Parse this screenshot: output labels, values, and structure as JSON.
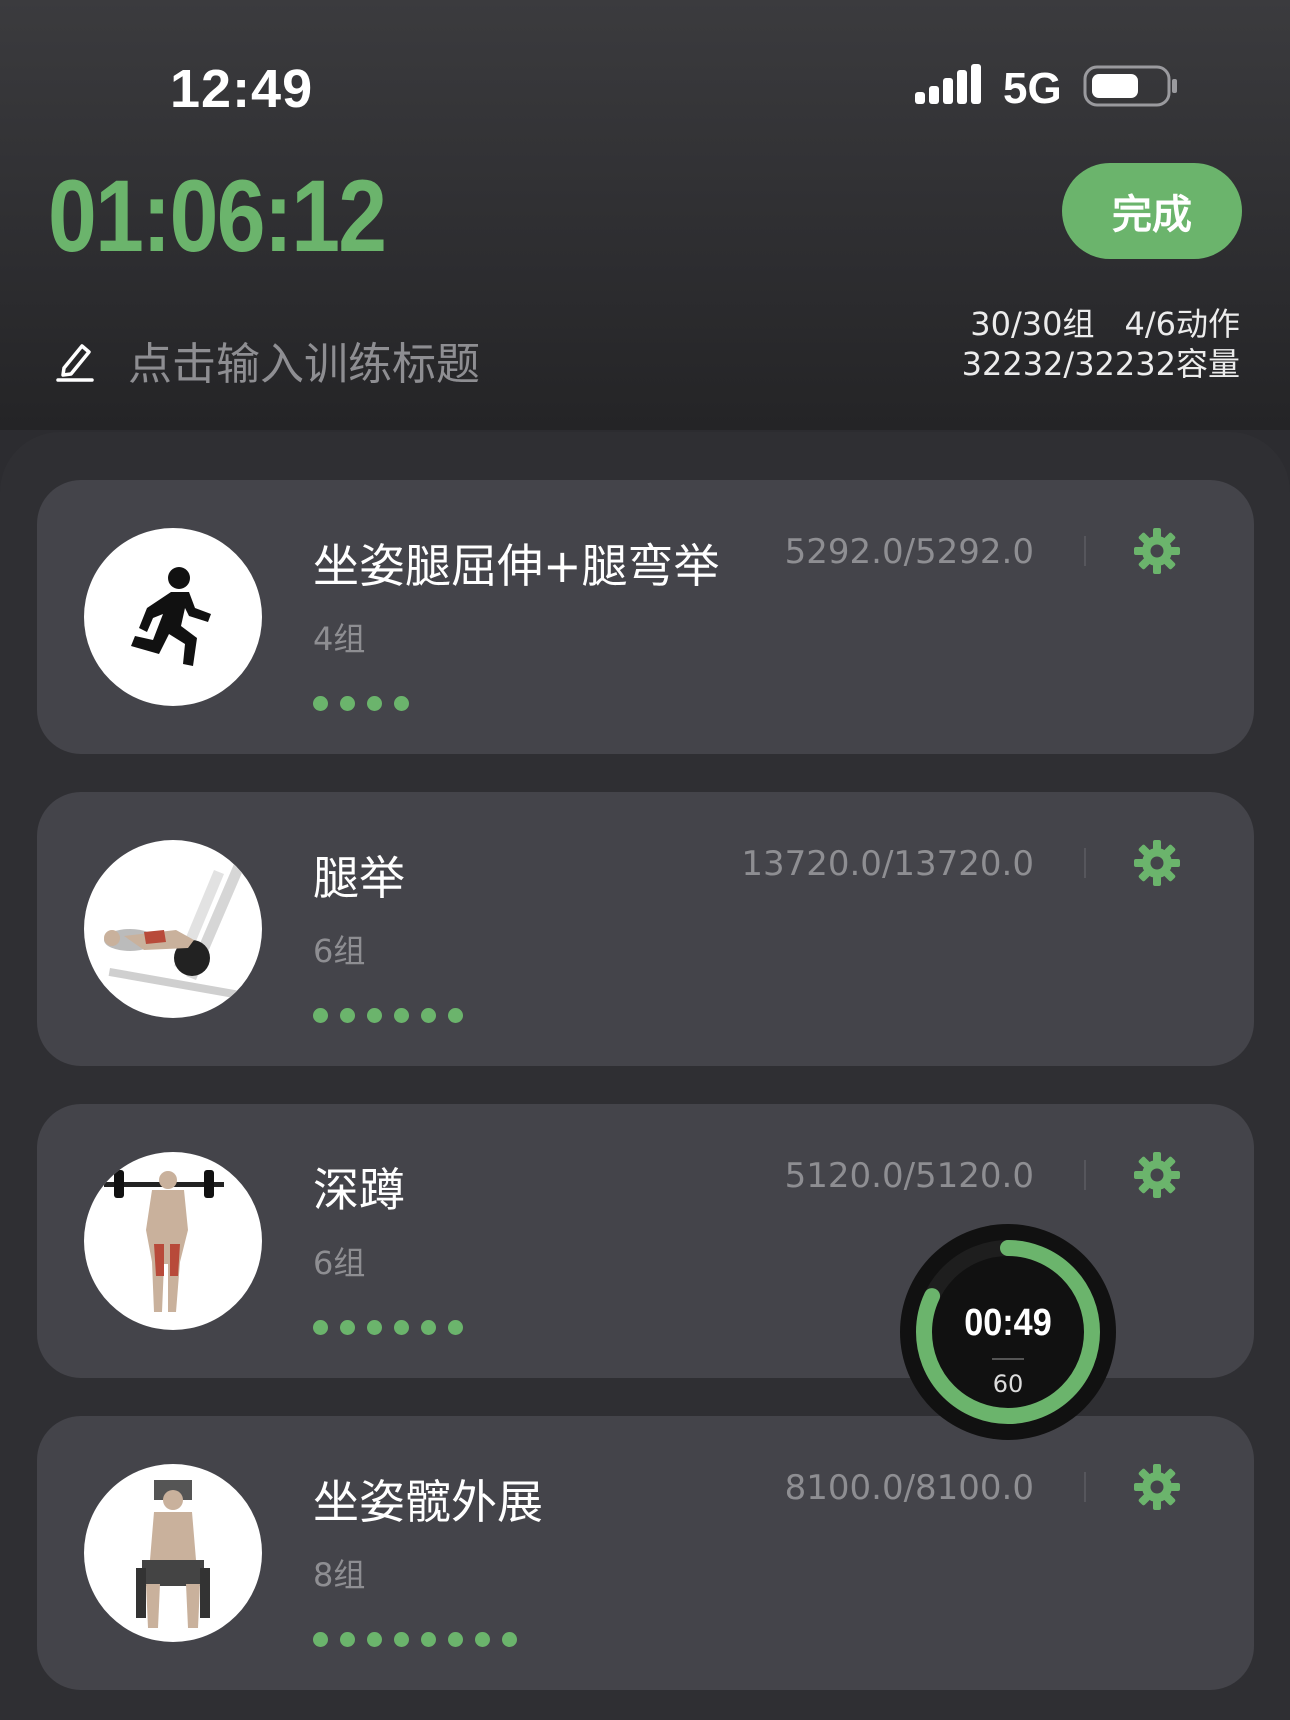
{
  "status_bar": {
    "time": "12:49",
    "network": "5G"
  },
  "header": {
    "elapsed": "01:06:12",
    "finish_label": "完成",
    "title_placeholder": "点击输入训练标题",
    "stats": {
      "sets": "30/30组",
      "exercises": "4/6动作",
      "volume": "32232/32232容量"
    }
  },
  "exercises": [
    {
      "name": "坐姿腿屈伸+腿弯举",
      "sets": "4组",
      "volume": "5292.0/5292.0",
      "completed_sets": 4,
      "icon": "running-person-icon"
    },
    {
      "name": "腿举",
      "sets": "6组",
      "volume": "13720.0/13720.0",
      "completed_sets": 6,
      "icon": "leg-press-illustration"
    },
    {
      "name": "深蹲",
      "sets": "6组",
      "volume": "5120.0/5120.0",
      "completed_sets": 6,
      "icon": "squat-illustration"
    },
    {
      "name": "坐姿髋外展",
      "sets": "8组",
      "volume": "8100.0/8100.0",
      "completed_sets": 8,
      "icon": "hip-abduction-illustration"
    }
  ],
  "rest_timer": {
    "remaining": "00:49",
    "total": "60",
    "progress": 0.82
  },
  "colors": {
    "accent": "#6bb46c",
    "card": "#44444a",
    "background": "#2c2c30"
  }
}
